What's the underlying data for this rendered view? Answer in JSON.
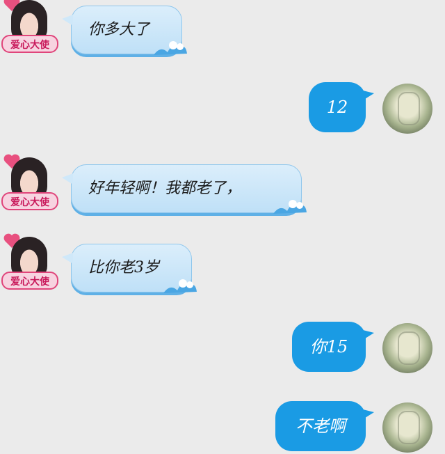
{
  "chat": {
    "messages": [
      {
        "side": "left",
        "text": "你多大了"
      },
      {
        "side": "right",
        "text": "12"
      },
      {
        "side": "left",
        "text": "好年轻啊！我都老了，"
      },
      {
        "side": "left",
        "text": "比你老3岁"
      },
      {
        "side": "right",
        "text": "你15"
      },
      {
        "side": "right",
        "text": "不老啊"
      }
    ],
    "friend_avatar_banner": "爱心大使"
  },
  "colors": {
    "background": "#ebebeb",
    "left_bubble": "#cfe8f9",
    "right_bubble": "#1a9be4",
    "banner_text": "#c8185a"
  }
}
